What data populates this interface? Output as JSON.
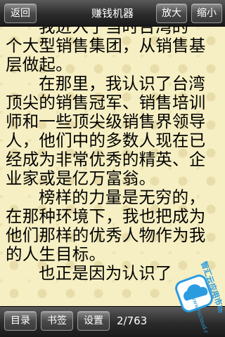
{
  "header": {
    "back_label": "返回",
    "title": "赚钱机器",
    "zoom_in_label": "放大",
    "zoom_out_label": "缩小"
  },
  "reader": {
    "paragraphs": [
      "我进入了当时台湾的一个大型销售集团，从销售基层做起。",
      "在那里，我认识了台湾顶尖的销售冠军、销售培训师和一些顶尖级销售界领导人，他们中的多数人现在已经成为非常优秀的精英、企业家或是亿万富翁。",
      "榜样的力量是无穷的，在那种环境下，我也把成为他们那样的优秀人物作为我的人生目标。",
      "也正是因为认识了"
    ]
  },
  "footer": {
    "toc_label": "目录",
    "bookmark_label": "书签",
    "settings_label": "设置",
    "page_indicator": "2/763"
  },
  "watermark": {
    "text": "智汇云应用市场",
    "url": "www.hicloud.com",
    "icon": "cloud-icon"
  },
  "colors": {
    "paper": "#f6efc3",
    "bar": "#2b2b2b",
    "badge": "#2b9be0"
  }
}
